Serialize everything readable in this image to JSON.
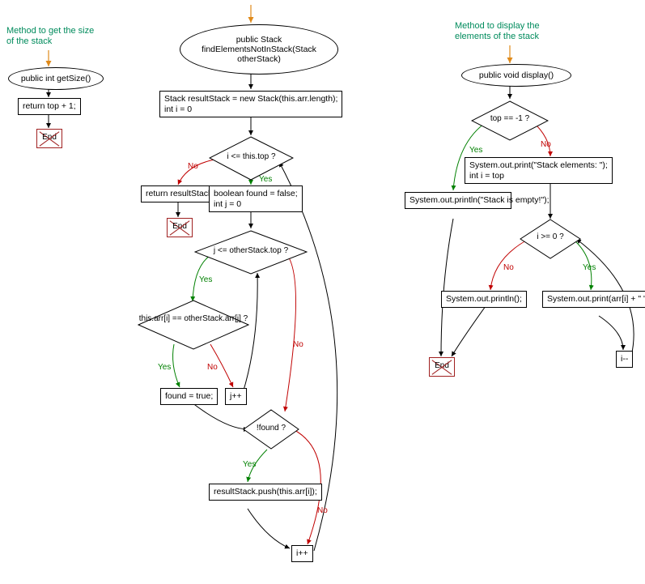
{
  "chart_data": [
    {
      "type": "flowchart",
      "title": "getSize",
      "comment": "Method to get the size of the stack",
      "nodes": {
        "start": "public int getSize()",
        "p1": "return top + 1;",
        "end": "End"
      },
      "edges": [
        {
          "from": "start",
          "to": "p1"
        },
        {
          "from": "p1",
          "to": "end"
        }
      ]
    },
    {
      "type": "flowchart",
      "title": "findElementsNotInStack",
      "nodes": {
        "start": "public Stack findElementsNotInStack(Stack otherStack)",
        "p1": "Stack resultStack = new Stack(this.arr.length);\nint i = 0",
        "d1": "i <= this.top ?",
        "p2": "return resultStack;",
        "p3": "boolean found = false;\nint j = 0",
        "d2": "j <= otherStack.top ?",
        "d3": "this.arr[i] == otherStack.arr[j] ?",
        "p4": "found = true;",
        "p5": "j++",
        "d4": "!found ?",
        "p6": "resultStack.push(this.arr[i]);",
        "p7": "i++",
        "end": "End"
      },
      "edges": [
        {
          "from": "start",
          "to": "p1"
        },
        {
          "from": "p1",
          "to": "d1"
        },
        {
          "from": "d1",
          "to": "p2",
          "label": "No"
        },
        {
          "from": "d1",
          "to": "p3",
          "label": "Yes"
        },
        {
          "from": "p2",
          "to": "end"
        },
        {
          "from": "p3",
          "to": "d2"
        },
        {
          "from": "d2",
          "to": "d3",
          "label": "Yes"
        },
        {
          "from": "d2",
          "to": "d4",
          "label": "No"
        },
        {
          "from": "d3",
          "to": "p4",
          "label": "Yes"
        },
        {
          "from": "d3",
          "to": "p5",
          "label": "No"
        },
        {
          "from": "p4",
          "to": "d4"
        },
        {
          "from": "p5",
          "to": "d2"
        },
        {
          "from": "d4",
          "to": "p6",
          "label": "Yes"
        },
        {
          "from": "d4",
          "to": "p7",
          "label": "No"
        },
        {
          "from": "p6",
          "to": "p7"
        },
        {
          "from": "p7",
          "to": "d1"
        }
      ]
    },
    {
      "type": "flowchart",
      "title": "display",
      "comment": "Method to display the elements of the stack",
      "nodes": {
        "start": "public void display()",
        "d1": "top == -1 ?",
        "p1": "System.out.println(\"Stack is empty!\");",
        "p2": "System.out.print(\"Stack elements: \");\nint i = top",
        "d2": "i >= 0 ?",
        "p3": "System.out.println();",
        "p4": "System.out.print(arr[i] + \" \");",
        "p5": "i--",
        "end": "End"
      },
      "edges": [
        {
          "from": "start",
          "to": "d1"
        },
        {
          "from": "d1",
          "to": "p1",
          "label": "Yes"
        },
        {
          "from": "d1",
          "to": "p2",
          "label": "No"
        },
        {
          "from": "p1",
          "to": "end"
        },
        {
          "from": "p2",
          "to": "d2"
        },
        {
          "from": "d2",
          "to": "p3",
          "label": "No"
        },
        {
          "from": "d2",
          "to": "p4",
          "label": "Yes"
        },
        {
          "from": "p3",
          "to": "end"
        },
        {
          "from": "p4",
          "to": "p5"
        },
        {
          "from": "p5",
          "to": "d2"
        }
      ]
    }
  ],
  "colors": {
    "yes": "#008000",
    "no": "#c00000",
    "comment": "#008b5c",
    "arrow": "#e08a1a"
  }
}
